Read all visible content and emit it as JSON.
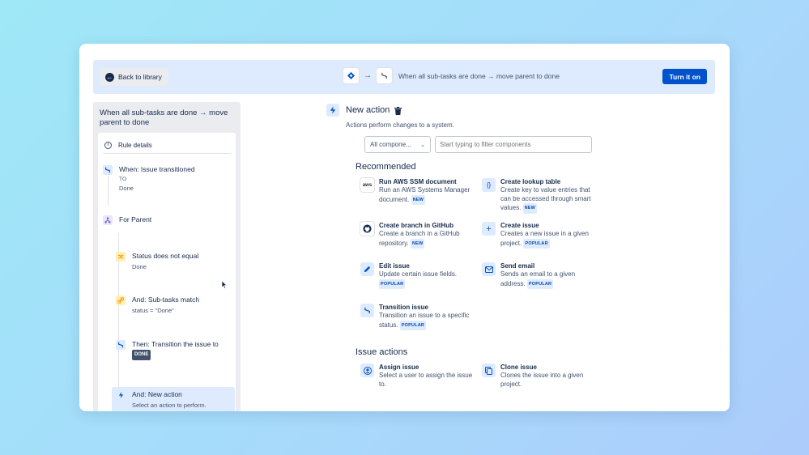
{
  "colors": {
    "primary": "#0052cc",
    "topbar_bg": "#deebff",
    "sidebar_bg": "#ebecf0",
    "lozenge_dark": "#42526e"
  },
  "topbar": {
    "back_label": "Back to library",
    "rule_flow_title": "When all sub-tasks are done → move parent to done",
    "turn_on_label": "Turn it on"
  },
  "sidebar": {
    "title": "When all sub-tasks are done → move parent to done",
    "rule_details": "Rule details",
    "trigger": {
      "title": "When: Issue transitioned",
      "meta": "TO",
      "value": "Done"
    },
    "branch": {
      "title": "For Parent"
    },
    "condition1": {
      "title": "Status does not equal",
      "value": "Done"
    },
    "condition2": {
      "title": "And: Sub-tasks match",
      "value": "status = \"Done\""
    },
    "action1": {
      "title": "Then: Transition the issue to",
      "lozenge": "DONE"
    },
    "action2": {
      "title": "And: New action",
      "value": "Select an action to perform."
    }
  },
  "main": {
    "title": "New action",
    "description": "Actions perform changes to a system.",
    "select_value": "All compone...",
    "filter_placeholder": "Start typing to filter components",
    "recommended_heading": "Recommended",
    "issue_actions_heading": "Issue actions",
    "recommended": [
      {
        "icon": "aws-icon",
        "title": "Run AWS SSM document",
        "desc": "Run an AWS Systems Manager document.",
        "lozenge": "NEW"
      },
      {
        "icon": "braces-icon",
        "title": "Create lookup table",
        "desc": "Create key to value entries that can be accessed through smart values.",
        "lozenge": "NEW"
      },
      {
        "icon": "github-icon",
        "title": "Create branch in GitHub",
        "desc": "Create a branch in a GitHub repository.",
        "lozenge": "NEW"
      },
      {
        "icon": "plus-icon",
        "title": "Create issue",
        "desc": "Creates a new issue in a given project.",
        "lozenge": "POPULAR"
      },
      {
        "icon": "pencil-icon",
        "title": "Edit issue",
        "desc": "Update certain issue fields.",
        "lozenge": "POPULAR"
      },
      {
        "icon": "envelope-icon",
        "title": "Send email",
        "desc": "Sends an email to a given address.",
        "lozenge": "POPULAR"
      },
      {
        "icon": "transition-icon",
        "title": "Transition issue",
        "desc": "Transition an issue to a specific status.",
        "lozenge": "POPULAR"
      }
    ],
    "issue_actions": [
      {
        "icon": "user-icon",
        "title": "Assign issue",
        "desc": "Select a user to assign the issue to."
      },
      {
        "icon": "copy-icon",
        "title": "Clone issue",
        "desc": "Clones the issue into a given project."
      }
    ]
  }
}
